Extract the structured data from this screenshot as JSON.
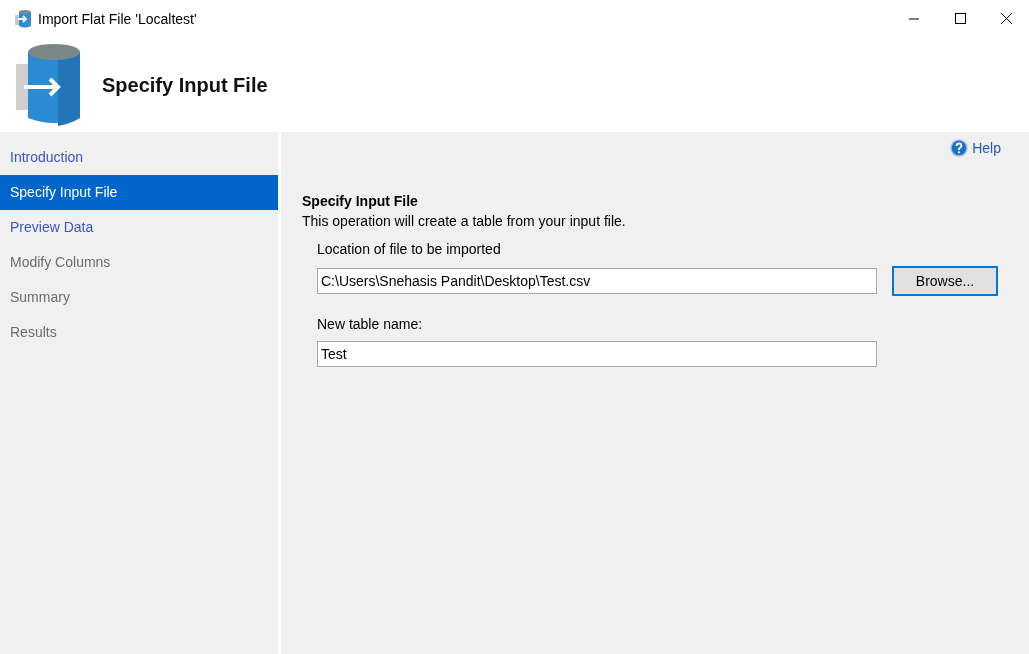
{
  "window": {
    "title": "Import Flat File 'Localtest'"
  },
  "header": {
    "title": "Specify Input File"
  },
  "sidebar": {
    "items": [
      {
        "label": "Introduction",
        "selected": false,
        "disabled": false
      },
      {
        "label": "Specify Input File",
        "selected": true,
        "disabled": false
      },
      {
        "label": "Preview Data",
        "selected": false,
        "disabled": false
      },
      {
        "label": "Modify Columns",
        "selected": false,
        "disabled": true
      },
      {
        "label": "Summary",
        "selected": false,
        "disabled": true
      },
      {
        "label": "Results",
        "selected": false,
        "disabled": true
      }
    ]
  },
  "help": {
    "label": "Help"
  },
  "content": {
    "heading": "Specify Input File",
    "description": "This operation will create a table from your input file.",
    "location": {
      "label": "Location of file to be imported",
      "value": "C:\\Users\\Snehasis Pandit\\Desktop\\Test.csv",
      "button": "Browse..."
    },
    "table_name": {
      "label": "New table name:",
      "value": "Test"
    }
  }
}
